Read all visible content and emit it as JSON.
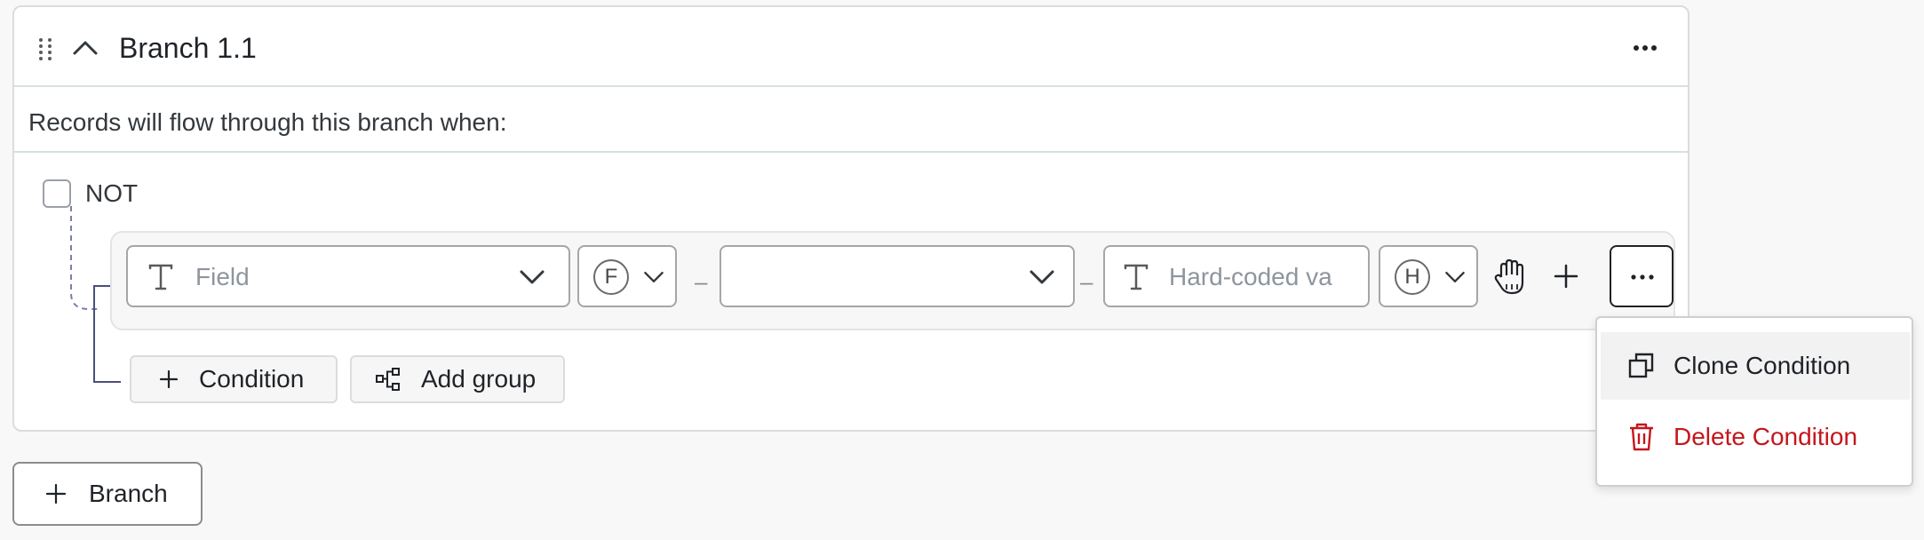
{
  "branch": {
    "title": "Branch 1.1",
    "flow_text": "Records will flow through this branch when:",
    "not_label": "NOT",
    "not_checked": false
  },
  "condition": {
    "field_placeholder": "Field",
    "function_badge": "F",
    "operator_value": "",
    "value_placeholder": "Hard-coded va",
    "value_badge": "H",
    "separator": "–"
  },
  "buttons": {
    "add_condition": "Condition",
    "add_group": "Add group",
    "add_branch": "Branch"
  },
  "context_menu": {
    "clone": "Clone Condition",
    "delete": "Delete Condition"
  },
  "colors": {
    "danger": "#c4161c",
    "border": "#dcdcdc"
  }
}
